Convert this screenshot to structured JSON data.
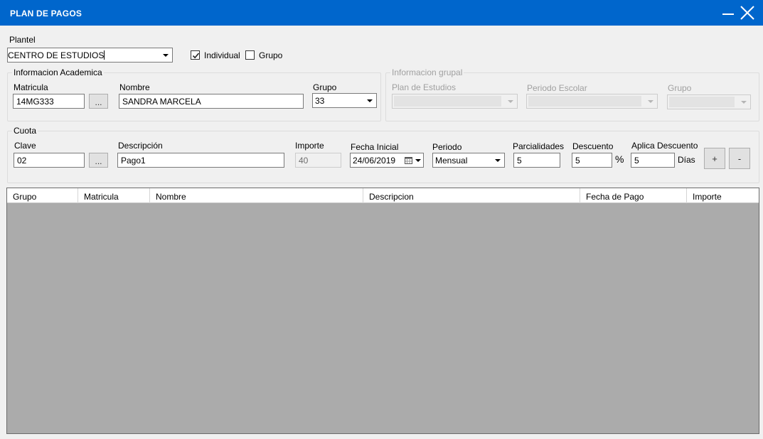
{
  "window": {
    "title": "PLAN DE PAGOS",
    "minimize_icon": "minimize-icon",
    "close_icon": "close-icon"
  },
  "plantel": {
    "label": "Plantel",
    "value": "CENTRO DE ESTUDIOS",
    "individual_label": "Individual",
    "individual_checked": true,
    "grupo_label": "Grupo",
    "grupo_checked": false
  },
  "info_academica": {
    "legend": "Informacion Academica",
    "matricula_label": "Matricula",
    "matricula_value": "14MG333",
    "browse_label": "...",
    "nombre_label": "Nombre",
    "nombre_value": "SANDRA MARCELA",
    "grupo_label": "Grupo",
    "grupo_value": "33"
  },
  "info_grupal": {
    "legend": "Informacion grupal",
    "plan_label": "Plan de Estudios",
    "periodo_label": "Periodo Escolar",
    "grupo_label": "Grupo"
  },
  "cuota": {
    "legend": "Cuota",
    "clave_label": "Clave",
    "clave_value": "02",
    "browse_label": "...",
    "descripcion_label": "Descripción",
    "descripcion_value": "Pago1",
    "importe_label": "Importe",
    "importe_value": "40",
    "fecha_label": "Fecha Inicial",
    "fecha_value": "24/06/2019",
    "periodo_label": "Periodo",
    "periodo_value": "Mensual",
    "parcialidades_label": "Parcialidades",
    "parcialidades_value": "5",
    "descuento_label": "Descuento",
    "descuento_value": "5",
    "percent_symbol": "%",
    "aplica_label": "Aplica Descuento",
    "aplica_value": "5",
    "dias_label": "Días",
    "add_label": "+",
    "remove_label": "-"
  },
  "table": {
    "columns": [
      "Grupo",
      "Matricula",
      "Nombre",
      "Descripcion",
      "Fecha de Pago",
      "Importe"
    ],
    "rows": []
  },
  "colors": {
    "titlebar": "#0066cc",
    "grid_background": "#ababab",
    "window_background": "#f0f0f0"
  }
}
